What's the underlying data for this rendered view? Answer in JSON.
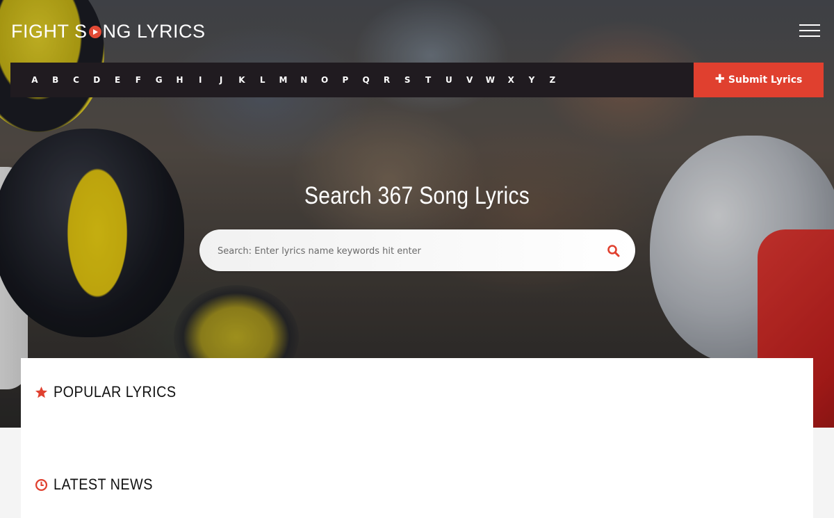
{
  "brand": {
    "logo_text_left": "FIGHT S",
    "logo_text_right": "NG LYRICS",
    "accent_color": "#e0402f"
  },
  "header": {
    "menu_icon": "hamburger-menu-icon"
  },
  "alphabet_nav": [
    "A",
    "B",
    "C",
    "D",
    "E",
    "F",
    "G",
    "H",
    "I",
    "J",
    "K",
    "L",
    "M",
    "N",
    "O",
    "P",
    "Q",
    "R",
    "S",
    "T",
    "U",
    "V",
    "W",
    "X",
    "Y",
    "Z"
  ],
  "submit": {
    "icon": "plus-icon",
    "label": "Submit Lyrics"
  },
  "search": {
    "title": "Search 367 Song Lyrics",
    "placeholder": "Search: Enter lyrics name keywords hit enter",
    "value": "",
    "icon": "search-icon"
  },
  "sections": {
    "popular": {
      "icon": "star-icon",
      "title": "POPULAR LYRICS"
    },
    "latest": {
      "icon": "clock-icon",
      "title": "LATEST NEWS"
    }
  }
}
